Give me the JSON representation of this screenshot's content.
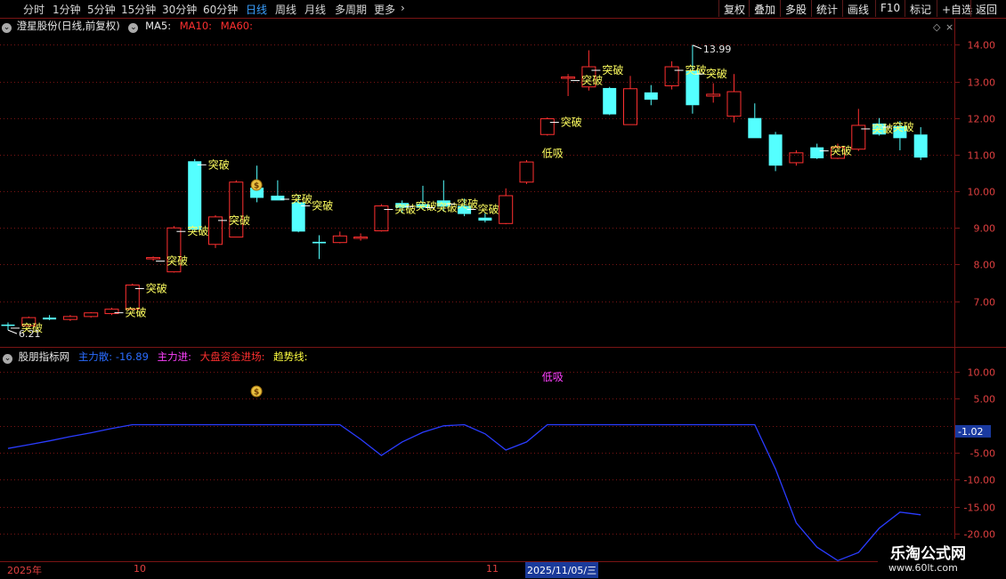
{
  "toolbar": {
    "periods": [
      "分时",
      "1分钟",
      "5分钟",
      "15分钟",
      "30分钟",
      "60分钟",
      "日线",
      "周线",
      "月线",
      "多周期",
      "更多"
    ],
    "active_period": "日线",
    "more_chevron": "›",
    "buttons": [
      "复权",
      "叠加",
      "多股",
      "统计",
      "画线",
      "F10",
      "标记",
      "+自选",
      "返回"
    ]
  },
  "price_header": {
    "stock_name": "澄星股份(日线,前复权)",
    "ma5": "MA5:",
    "ma10": "MA10:",
    "ma60": "MA60:"
  },
  "indicator_header": {
    "name": "股朋指标网",
    "main_force_label": "主力散:",
    "main_force_value": "-16.89",
    "main_in_label": "主力进:",
    "market_funds_label": "大盘资金进场:",
    "trend_label": "趋势线:"
  },
  "price_axis": {
    "ticks": [
      "14.00",
      "13.00",
      "12.00",
      "11.00",
      "10.00",
      "9.00",
      "8.00",
      "7.00"
    ]
  },
  "indicator_axis": {
    "ticks": [
      "10.00",
      "5.00",
      "-5.00",
      "-10.00",
      "-15.00",
      "-20.00"
    ],
    "current_value": "-1.02"
  },
  "markers": {
    "breakout": "突破",
    "low_buy": "低吸",
    "high_price": "13.99",
    "low_price": "6.21",
    "money_bag": "$"
  },
  "dates": {
    "year": "2025年",
    "month_oct": "10",
    "month_nov": "11",
    "selected_date": "2025/11/05/三"
  },
  "watermark": {
    "title": "乐淘公式网",
    "url": "www.60lt.com"
  },
  "colors": {
    "up": "#ff3030",
    "down": "#54ffff",
    "grid": "#7a1414",
    "axis_text": "#e04040",
    "indicator_line": "#2a3cff",
    "breakout_text": "#ffff60"
  },
  "chart_data": {
    "type": "candlestick",
    "candles": [
      {
        "o": 6.36,
        "h": 6.42,
        "l": 6.21,
        "c": 6.33
      },
      {
        "o": 6.33,
        "h": 6.58,
        "l": 6.3,
        "c": 6.55
      },
      {
        "o": 6.55,
        "h": 6.62,
        "l": 6.48,
        "c": 6.5
      },
      {
        "o": 6.5,
        "h": 6.62,
        "l": 6.46,
        "c": 6.58
      },
      {
        "o": 6.58,
        "h": 6.7,
        "l": 6.55,
        "c": 6.68
      },
      {
        "o": 6.66,
        "h": 6.82,
        "l": 6.62,
        "c": 6.78
      },
      {
        "o": 6.78,
        "h": 7.48,
        "l": 6.75,
        "c": 7.44
      },
      {
        "o": 8.16,
        "h": 8.22,
        "l": 8.1,
        "c": 8.19
      },
      {
        "o": 7.8,
        "h": 9.05,
        "l": 7.78,
        "c": 9.0
      },
      {
        "o": 10.82,
        "h": 10.88,
        "l": 8.9,
        "c": 8.95
      },
      {
        "o": 8.55,
        "h": 9.35,
        "l": 8.45,
        "c": 9.3
      },
      {
        "o": 8.75,
        "h": 10.3,
        "l": 8.75,
        "c": 10.25
      },
      {
        "o": 10.1,
        "h": 10.7,
        "l": 9.7,
        "c": 9.82
      },
      {
        "o": 9.88,
        "h": 10.3,
        "l": 9.75,
        "c": 9.75
      },
      {
        "o": 9.7,
        "h": 9.9,
        "l": 8.88,
        "c": 8.9
      },
      {
        "o": 8.62,
        "h": 8.8,
        "l": 8.15,
        "c": 8.58
      },
      {
        "o": 8.6,
        "h": 8.9,
        "l": 8.58,
        "c": 8.78
      },
      {
        "o": 8.72,
        "h": 8.85,
        "l": 8.65,
        "c": 8.75
      },
      {
        "o": 8.92,
        "h": 9.65,
        "l": 8.9,
        "c": 9.6
      },
      {
        "o": 9.68,
        "h": 9.75,
        "l": 9.4,
        "c": 9.55
      },
      {
        "o": 9.65,
        "h": 10.15,
        "l": 9.5,
        "c": 9.55
      },
      {
        "o": 9.75,
        "h": 10.3,
        "l": 9.45,
        "c": 9.58
      },
      {
        "o": 9.6,
        "h": 9.8,
        "l": 9.32,
        "c": 9.38
      },
      {
        "o": 9.28,
        "h": 9.4,
        "l": 9.15,
        "c": 9.2
      },
      {
        "o": 9.12,
        "h": 10.08,
        "l": 9.1,
        "c": 9.88
      },
      {
        "o": 10.25,
        "h": 10.85,
        "l": 10.2,
        "c": 10.8
      },
      {
        "o": 11.55,
        "h": 12.02,
        "l": 11.52,
        "c": 11.98
      },
      {
        "o": 13.1,
        "h": 13.2,
        "l": 12.6,
        "c": 13.12
      },
      {
        "o": 12.85,
        "h": 13.85,
        "l": 12.75,
        "c": 13.4
      },
      {
        "o": 12.82,
        "h": 12.85,
        "l": 12.08,
        "c": 12.1
      },
      {
        "o": 11.82,
        "h": 13.15,
        "l": 11.82,
        "c": 12.8
      },
      {
        "o": 12.7,
        "h": 12.9,
        "l": 12.35,
        "c": 12.5
      },
      {
        "o": 12.88,
        "h": 13.55,
        "l": 12.78,
        "c": 13.4
      },
      {
        "o": 13.3,
        "h": 13.99,
        "l": 12.12,
        "c": 12.35
      },
      {
        "o": 12.6,
        "h": 12.95,
        "l": 12.42,
        "c": 12.65
      },
      {
        "o": 12.05,
        "h": 13.2,
        "l": 11.88,
        "c": 12.72
      },
      {
        "o": 12.0,
        "h": 12.4,
        "l": 11.45,
        "c": 11.45
      },
      {
        "o": 11.55,
        "h": 11.62,
        "l": 10.55,
        "c": 10.7
      },
      {
        "o": 10.78,
        "h": 11.12,
        "l": 10.7,
        "c": 11.05
      },
      {
        "o": 11.2,
        "h": 11.3,
        "l": 10.88,
        "c": 10.9
      },
      {
        "o": 10.9,
        "h": 11.3,
        "l": 10.88,
        "c": 11.2
      },
      {
        "o": 11.15,
        "h": 12.25,
        "l": 11.1,
        "c": 11.8
      },
      {
        "o": 11.85,
        "h": 12.0,
        "l": 11.52,
        "c": 11.55
      },
      {
        "o": 11.78,
        "h": 11.92,
        "l": 11.12,
        "c": 11.45
      },
      {
        "o": 11.55,
        "h": 11.75,
        "l": 10.85,
        "c": 10.92
      }
    ],
    "breakout_bars": [
      0,
      5,
      6,
      7,
      8,
      9,
      10,
      13,
      14,
      18,
      19,
      20,
      21,
      22,
      26,
      27,
      28,
      32,
      33,
      39,
      41,
      42
    ],
    "low_buy_bars": [
      26
    ],
    "indicator_line": [
      -4.2,
      -3.5,
      -2.8,
      -2.0,
      -1.3,
      -0.5,
      0.2,
      0.2,
      0.2,
      0.2,
      0.2,
      0.2,
      0.2,
      0.2,
      0.2,
      0.2,
      0.2,
      -2.5,
      -5.5,
      -3.0,
      -1.2,
      0.0,
      0.2,
      -1.5,
      -4.5,
      -3.0,
      0.2,
      0.2,
      0.2,
      0.2,
      0.2,
      0.2,
      0.2,
      0.2,
      0.2,
      0.2,
      0.2,
      -8.0,
      -18.0,
      -22.5,
      -25.0,
      -23.5,
      -19.0,
      -16.0,
      -16.5
    ],
    "ylim_price": [
      5.8,
      14.3
    ],
    "ylim_indicator": [
      -20,
      12
    ]
  }
}
